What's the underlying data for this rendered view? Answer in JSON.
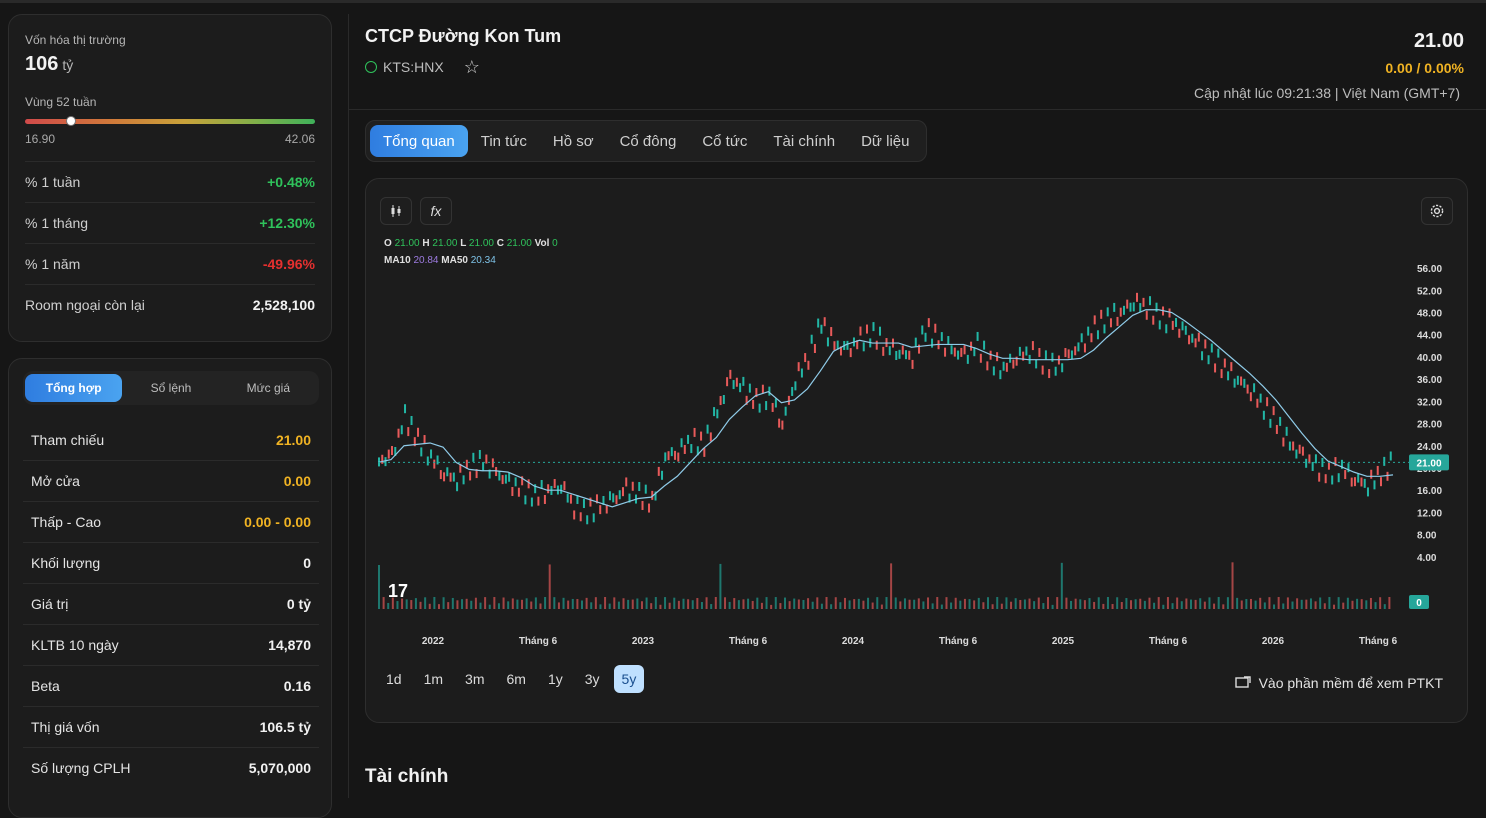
{
  "summary": {
    "market_cap_label": "Vốn hóa thị trường",
    "market_cap_value": "106",
    "market_cap_unit": "tỷ",
    "range_label": "Vùng 52 tuần",
    "range_min": "16.90",
    "range_max": "42.06",
    "range_position": 0.16,
    "rows": [
      {
        "label": "% 1 tuần",
        "value": "+0.48%",
        "tone": "green"
      },
      {
        "label": "% 1 tháng",
        "value": "+12.30%",
        "tone": "green"
      },
      {
        "label": "% 1 năm",
        "value": "-49.96%",
        "tone": "red"
      },
      {
        "label": "Room ngoại còn lại",
        "value": "2,528,100",
        "tone": "white"
      }
    ]
  },
  "quote_tabs": [
    "Tổng hợp",
    "Sổ lệnh",
    "Mức giá"
  ],
  "quote_rows": [
    {
      "label": "Tham chiếu",
      "value": "21.00",
      "tone": "yellow"
    },
    {
      "label": "Mở cửa",
      "value": "0.00",
      "tone": "yellow"
    },
    {
      "label": "Thấp - Cao",
      "value": "0.00 - 0.00",
      "tone": "yellow"
    },
    {
      "label": "Khối lượng",
      "value": "0",
      "tone": "white"
    },
    {
      "label": "Giá trị",
      "value": "0 tỷ",
      "tone": "white"
    },
    {
      "label": "KLTB 10 ngày",
      "value": "14,870",
      "tone": "white"
    },
    {
      "label": "Beta",
      "value": "0.16",
      "tone": "white"
    },
    {
      "label": "Thị giá vốn",
      "value": "106.5 tỷ",
      "tone": "white"
    },
    {
      "label": "Số lượng CPLH",
      "value": "5,070,000",
      "tone": "white"
    }
  ],
  "header": {
    "company": "CTCP Đường Kon Tum",
    "ticker": "KTS:HNX",
    "price": "21.00",
    "change": "0.00 / 0.00%",
    "updated": "Cập nhật lúc 09:21:38 | Việt Nam (GMT+7)"
  },
  "tabs": [
    "Tổng quan",
    "Tin tức",
    "Hồ sơ",
    "Cổ đông",
    "Cổ tức",
    "Tài chính",
    "Dữ liệu"
  ],
  "chart_tools": {
    "function_icon": "fx"
  },
  "legend": {
    "O": "21.00",
    "H": "21.00",
    "L": "21.00",
    "C": "21.00",
    "Vol": "0",
    "MA10": "20.84",
    "MA50": "20.34",
    "labels": {
      "o": "O",
      "h": "H",
      "l": "L",
      "c": "C",
      "vol": "Vol",
      "ma10": "MA10",
      "ma50": "MA50"
    }
  },
  "chart_data": {
    "type": "line",
    "y_ticks": [
      "56.00",
      "52.00",
      "48.00",
      "44.00",
      "40.00",
      "36.00",
      "32.00",
      "28.00",
      "24.00",
      "20.00",
      "16.00",
      "12.00",
      "8.00",
      "4.00"
    ],
    "x_ticks": [
      "2022",
      "Tháng 6",
      "2023",
      "Tháng 6",
      "2024",
      "Tháng 6",
      "2025",
      "Tháng 6",
      "2026",
      "Tháng 6"
    ],
    "ylim": [
      0,
      58
    ],
    "last_price_label": "21.00",
    "last_volume_label": "0",
    "price_series": [
      21,
      22,
      29,
      25,
      22,
      19,
      18,
      20,
      21,
      19,
      17,
      16,
      15,
      16,
      17,
      13,
      12,
      13,
      14,
      16,
      15,
      14,
      22,
      23,
      25,
      24,
      30,
      36,
      34,
      32,
      33,
      28,
      36,
      40,
      46,
      42,
      41,
      43,
      44,
      42,
      41,
      40,
      45,
      43,
      41,
      40,
      42,
      39,
      38,
      40,
      41,
      39,
      38,
      40,
      42,
      45,
      47,
      48,
      50,
      49,
      47,
      46,
      44,
      42,
      40,
      38,
      36,
      34,
      31,
      28,
      24,
      22,
      20,
      19,
      20,
      18,
      17,
      19,
      21
    ]
  },
  "ranges": [
    "1d",
    "1m",
    "3m",
    "6m",
    "1y",
    "3y",
    "5y"
  ],
  "active_range": "5y",
  "ptkt_label": "Vào phần mềm để xem PTKT",
  "section_title": "Tài chính"
}
